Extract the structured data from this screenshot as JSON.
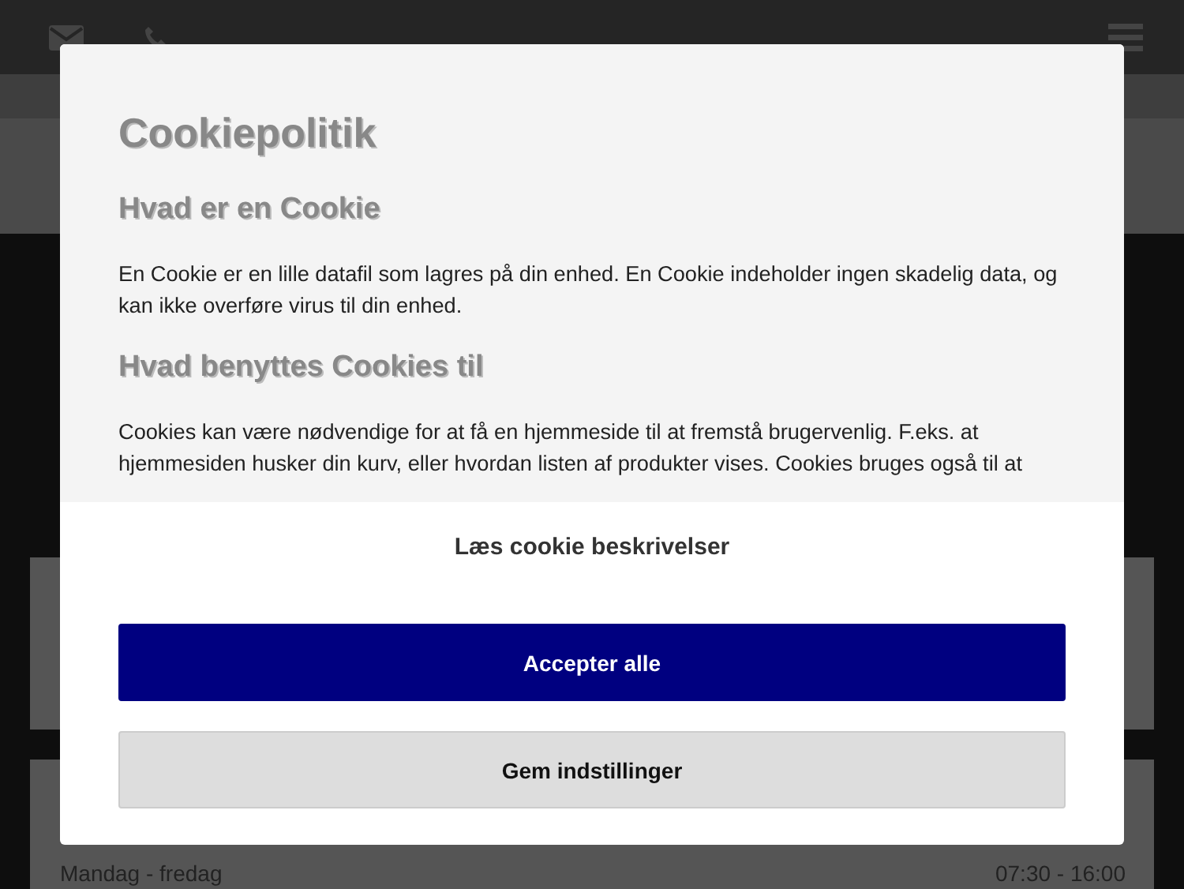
{
  "page": {
    "hours": [
      {
        "day": "Mandag - fredag",
        "time": "07:30 - 16:00"
      }
    ]
  },
  "cookie_dialog": {
    "title": "Cookiepolitik",
    "sections": [
      {
        "heading": "Hvad er en Cookie",
        "text": "En Cookie er en lille datafil som lagres på din enhed. En Cookie indeholder ingen skadelig data, og kan ikke overføre virus til din enhed."
      },
      {
        "heading": "Hvad benyttes Cookies til",
        "text": "Cookies kan være nødvendige for at få en hjemmeside til at fremstå brugervenlig. F.eks. at hjemmesiden husker din kurv, eller hvordan listen af produkter vises. Cookies bruges også til at"
      }
    ],
    "details_link": "Læs cookie beskrivelser",
    "buttons": [
      {
        "label": "Accepter alle",
        "kind": "primary"
      },
      {
        "label": "Gem indstillinger",
        "kind": "secondary"
      }
    ]
  }
}
